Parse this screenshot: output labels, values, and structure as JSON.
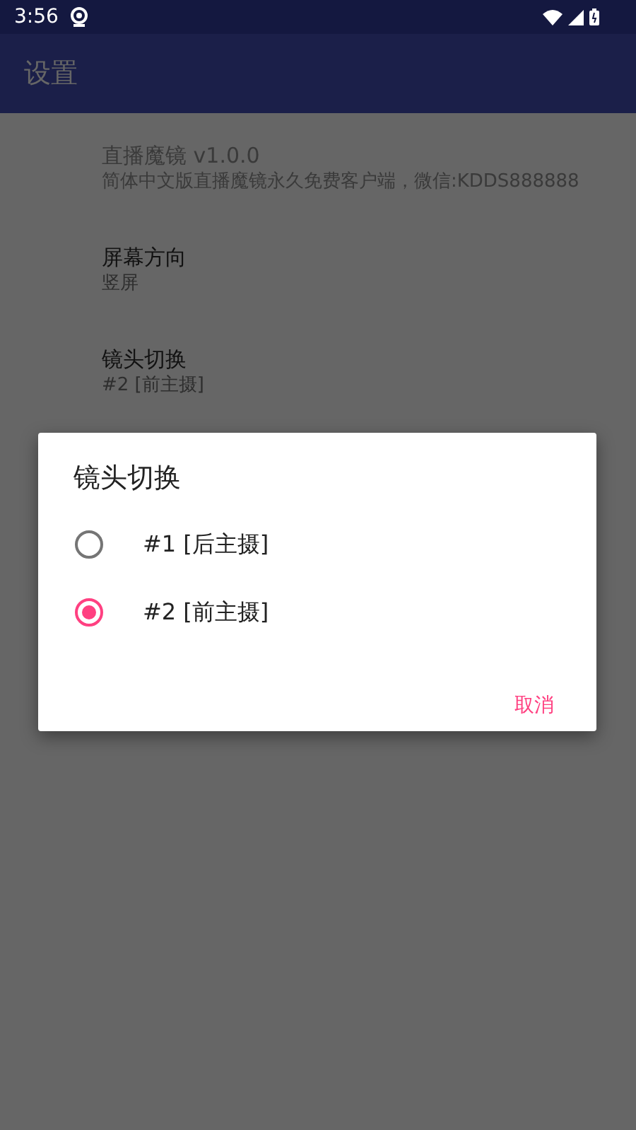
{
  "status_bar": {
    "time": "3:56"
  },
  "app_bar": {
    "title": "设置"
  },
  "preferences": [
    {
      "title": "直播魔镜 v1.0.0",
      "summary": "简体中文版直播魔镜永久免费客户端，微信:KDDS888888",
      "disabled": true
    },
    {
      "title": "屏幕方向",
      "summary": "竖屏",
      "disabled": false
    },
    {
      "title": "镜头切换",
      "summary": "#2 [前主摄]",
      "disabled": false
    }
  ],
  "dialog": {
    "title": "镜头切换",
    "options": [
      {
        "label": "#1 [后主摄]",
        "selected": false
      },
      {
        "label": "#2 [前主摄]",
        "selected": true
      }
    ],
    "cancel": "取消"
  }
}
